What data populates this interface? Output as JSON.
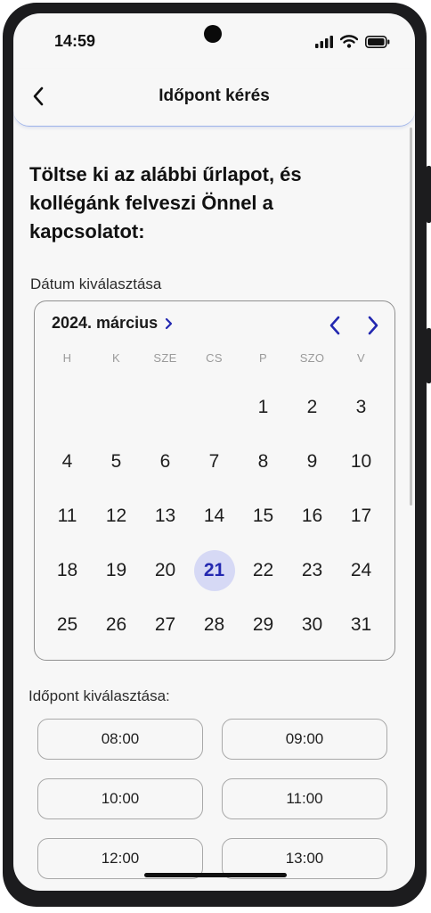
{
  "status_bar": {
    "time": "14:59",
    "icons": [
      "signal-icon",
      "wifi-icon",
      "battery-icon"
    ]
  },
  "header": {
    "title": "Időpont kérés",
    "back_icon": "chevron-left-icon"
  },
  "form": {
    "heading": "Töltse ki az alábbi űrlapot, és kollégánk felveszi Önnel a kapcsolatot:",
    "date_label": "Dátum kiválasztása",
    "time_label": "Időpont kiválasztása:"
  },
  "calendar": {
    "month_label": "2024. március",
    "weekdays": [
      "H",
      "K",
      "SZE",
      "CS",
      "P",
      "SZO",
      "V"
    ],
    "first_weekday_index": 4,
    "days": [
      "1",
      "2",
      "3",
      "4",
      "5",
      "6",
      "7",
      "8",
      "9",
      "10",
      "11",
      "12",
      "13",
      "14",
      "15",
      "16",
      "17",
      "18",
      "19",
      "20",
      "21",
      "22",
      "23",
      "24",
      "25",
      "26",
      "27",
      "28",
      "29",
      "30",
      "31"
    ],
    "selected_day": "21"
  },
  "time_slots": [
    "08:00",
    "09:00",
    "10:00",
    "11:00",
    "12:00",
    "13:00"
  ],
  "colors": {
    "accent": "#2328b0",
    "selected_bg": "#d6d9f5",
    "header_border": "#9db3ea"
  }
}
